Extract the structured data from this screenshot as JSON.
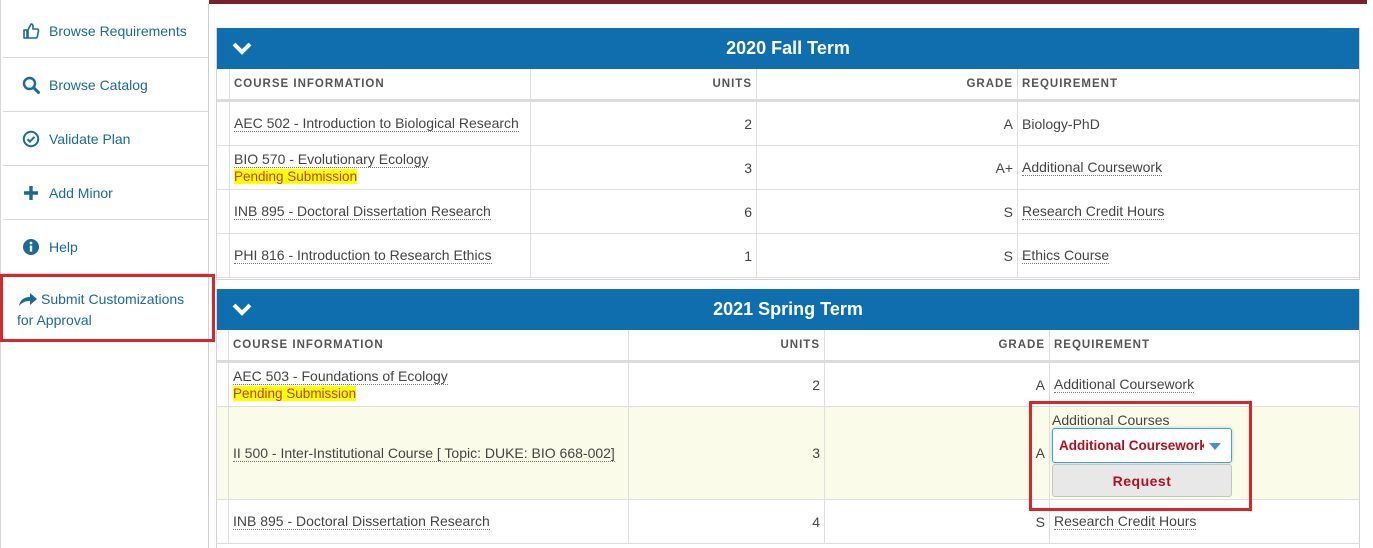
{
  "sidebar": {
    "items": [
      {
        "label": "Browse Requirements",
        "icon": "thumbs-up-icon"
      },
      {
        "label": "Browse Catalog",
        "icon": "search-icon"
      },
      {
        "label": "Validate Plan",
        "icon": "check-circle-icon"
      },
      {
        "label": "Add Minor",
        "icon": "plus-icon"
      },
      {
        "label": "Help",
        "icon": "info-icon"
      }
    ],
    "submit": {
      "line1": "Submit Customizations",
      "line2": "for Approval",
      "icon": "share-arrow-icon"
    }
  },
  "columns": {
    "course": "COURSE INFORMATION",
    "units": "UNITS",
    "grade": "GRADE",
    "requirement": "REQUIREMENT"
  },
  "terms": [
    {
      "title": "2020 Fall Term",
      "rows": [
        {
          "course": "AEC 502 - Introduction to Biological Research",
          "units": "2",
          "grade": "A",
          "requirement": "Biology-PhD"
        },
        {
          "course": "BIO 570 - Evolutionary Ecology",
          "status": "Pending Submission",
          "units": "3",
          "grade": "A+",
          "requirement": "Additional Coursework"
        },
        {
          "course": "INB 895 - Doctoral Dissertation Research",
          "units": "6",
          "grade": "S",
          "requirement": "Research Credit Hours"
        },
        {
          "course": "PHI 816 - Introduction to Research Ethics",
          "units": "1",
          "grade": "S",
          "requirement": "Ethics Course"
        }
      ]
    },
    {
      "title": "2021 Spring Term",
      "rows": [
        {
          "course": "AEC 503 - Foundations of Ecology",
          "status": "Pending Submission",
          "units": "2",
          "grade": "A",
          "requirement": "Additional Coursework"
        },
        {
          "course": "II 500 - Inter-Institutional Course [ Topic: DUKE: BIO 668-002]",
          "units": "3",
          "grade": "A",
          "requirement_label": "Additional Courses",
          "requirement_select": "Additional Coursework",
          "request_button": "Request"
        },
        {
          "course": "INB 895 - Doctoral Dissertation Research",
          "units": "4",
          "grade": "S",
          "requirement": "Research Credit Hours"
        }
      ]
    }
  ],
  "colors": {
    "header": "#0f6fae",
    "link": "#1a6a9a",
    "highlight": "#d9262b",
    "pending": "#ffff00",
    "accent": "#b3101c"
  }
}
